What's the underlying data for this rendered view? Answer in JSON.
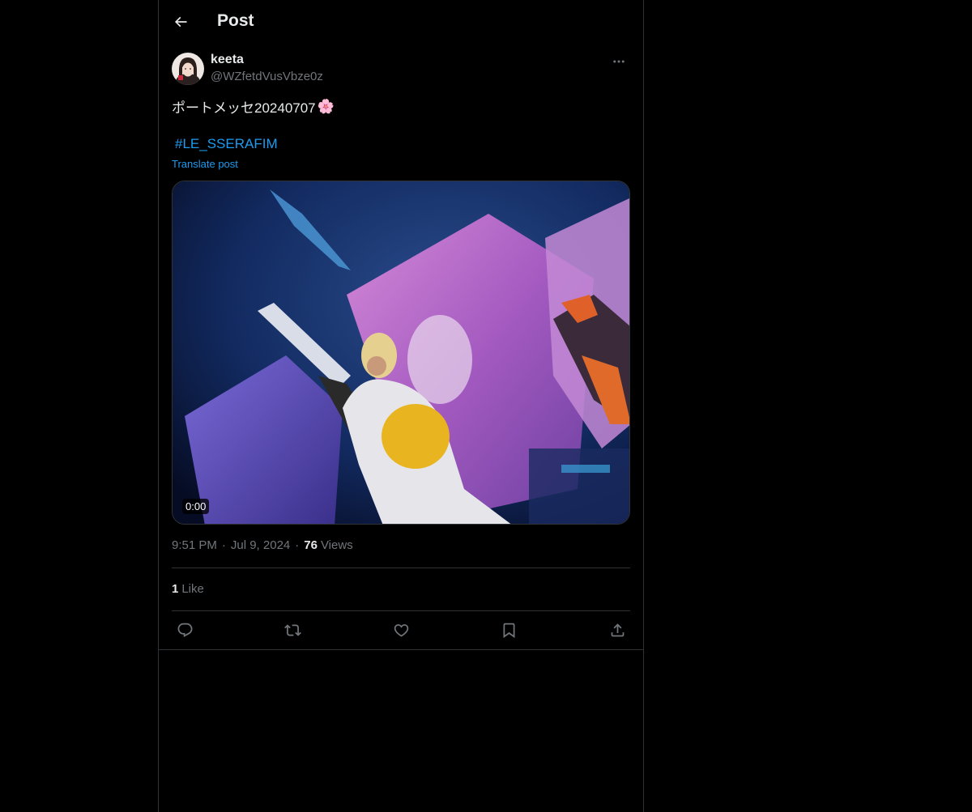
{
  "header": {
    "title": "Post",
    "back_icon": "arrow-left-icon"
  },
  "author": {
    "display_name": "keeta",
    "handle": "@WZfetdVusVbze0z",
    "more_icon": "more-horizontal-icon"
  },
  "post": {
    "text": "ポートメッセ20240707",
    "emoji": "🌸",
    "hashtag": "#LE_SSERAFIM",
    "translate_label": "Translate post"
  },
  "media": {
    "type": "video",
    "duration": "0:00"
  },
  "meta": {
    "time": "9:51 PM",
    "separator": "·",
    "date": "Jul 9, 2024",
    "views_count": "76",
    "views_label": "Views"
  },
  "engagement": {
    "likes_count": "1",
    "likes_label": "Like"
  },
  "actions": [
    {
      "name": "reply",
      "icon": "reply-icon"
    },
    {
      "name": "repost",
      "icon": "repost-icon"
    },
    {
      "name": "like",
      "icon": "heart-icon"
    },
    {
      "name": "bookmark",
      "icon": "bookmark-icon"
    },
    {
      "name": "share",
      "icon": "share-icon"
    }
  ],
  "colors": {
    "background": "#000000",
    "text_primary": "#e7e9ea",
    "text_secondary": "#71767b",
    "link": "#1d9bf0",
    "border": "#2f3336"
  }
}
